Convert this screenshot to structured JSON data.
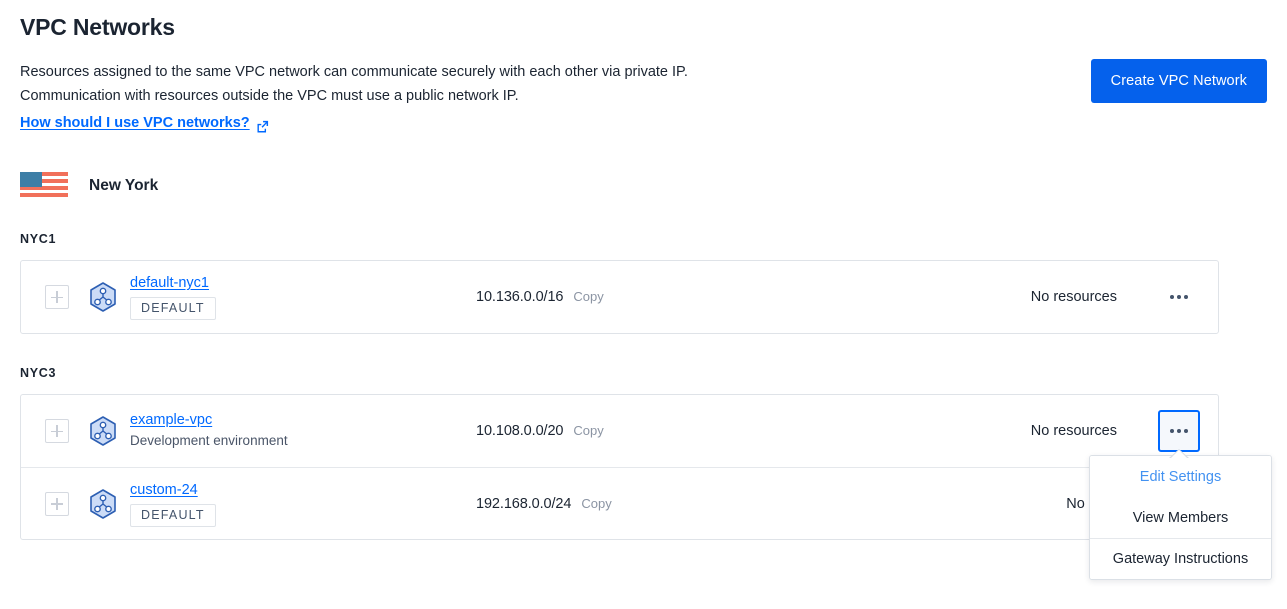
{
  "header": {
    "title": "VPC Networks",
    "description_line_1": "Resources assigned to the same VPC network can communicate securely with each other via private IP.",
    "description_line_2": "Communication with resources outside the VPC must use a public network IP.",
    "doc_link_label": "How should I use VPC networks?",
    "doc_link_icon": "external-link-icon",
    "create_button_label": "Create VPC Network",
    "create_button_color": "#0561ec"
  },
  "region": {
    "name": "New York",
    "flag_icon": "us-flag-icon",
    "flag_canton_color": "#3d7ea6",
    "flag_stripe_color": "#f1705a"
  },
  "groups": [
    {
      "datacenter": "NYC1",
      "rows": [
        {
          "expand_icon": "plus-icon",
          "network_icon": "vpc-network-icon",
          "name": "default-nyc1",
          "badge": "DEFAULT",
          "description": null,
          "ip_range": "10.136.0.0/16",
          "copy_label": "Copy",
          "resources": "No resources",
          "menu_icon": "kebab-menu-icon",
          "menu_open": false
        }
      ]
    },
    {
      "datacenter": "NYC3",
      "rows": [
        {
          "expand_icon": "plus-icon",
          "network_icon": "vpc-network-icon",
          "name": "example-vpc",
          "badge": null,
          "description": "Development environment",
          "ip_range": "10.108.0.0/20",
          "copy_label": "Copy",
          "resources": "No resources",
          "menu_icon": "kebab-menu-icon",
          "menu_open": true
        },
        {
          "expand_icon": "plus-icon",
          "network_icon": "vpc-network-icon",
          "name": "custom-24",
          "badge": "DEFAULT",
          "description": null,
          "ip_range": "192.168.0.0/24",
          "copy_label": "Copy",
          "resources": "No reso",
          "menu_icon": "kebab-menu-icon",
          "menu_open": false
        }
      ]
    }
  ],
  "dropdown": {
    "items": [
      {
        "label": "Edit Settings",
        "accent": true
      },
      {
        "label": "View Members",
        "accent": false
      },
      {
        "label": "Gateway Instructions",
        "accent": false
      }
    ],
    "accent_color": "#4392f1"
  }
}
